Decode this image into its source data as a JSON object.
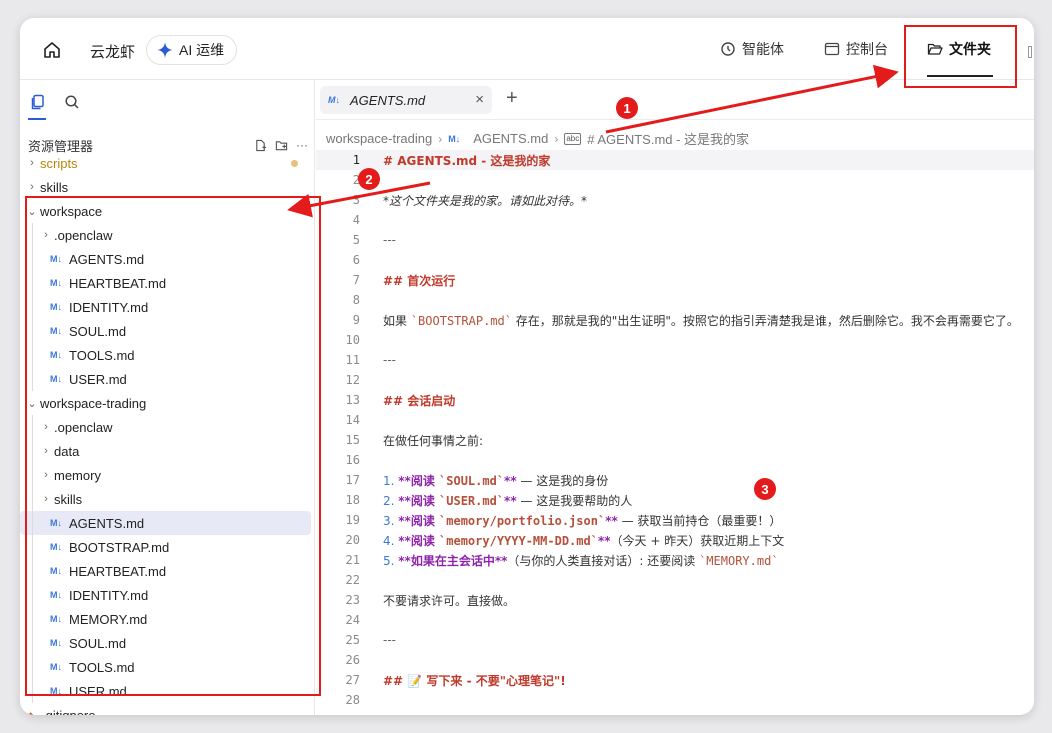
{
  "header": {
    "app_name": "云龙虾",
    "ai_button": "AI 运维",
    "nav": [
      {
        "label": "智能体"
      },
      {
        "label": "控制台"
      },
      {
        "label": "文件夹"
      }
    ]
  },
  "sidebar": {
    "explorer_title": "资源管理器",
    "more": "···",
    "tree": [
      {
        "label": "scripts",
        "kind": "folder",
        "chevron": "›",
        "color": "#b8860b"
      },
      {
        "label": "skills",
        "kind": "folder",
        "chevron": "›"
      },
      {
        "label": "workspace",
        "kind": "folder",
        "chevron": "⌄"
      },
      {
        "label": ".openclaw",
        "kind": "folder",
        "chevron": "›"
      },
      {
        "label": "AGENTS.md",
        "kind": "md"
      },
      {
        "label": "HEARTBEAT.md",
        "kind": "md"
      },
      {
        "label": "IDENTITY.md",
        "kind": "md"
      },
      {
        "label": "SOUL.md",
        "kind": "md"
      },
      {
        "label": "TOOLS.md",
        "kind": "md"
      },
      {
        "label": "USER.md",
        "kind": "md"
      },
      {
        "label": "workspace-trading",
        "kind": "folder",
        "chevron": "⌄"
      },
      {
        "label": ".openclaw",
        "kind": "folder",
        "chevron": "›"
      },
      {
        "label": "data",
        "kind": "folder",
        "chevron": "›"
      },
      {
        "label": "memory",
        "kind": "folder",
        "chevron": "›"
      },
      {
        "label": "skills",
        "kind": "folder",
        "chevron": "›"
      },
      {
        "label": "AGENTS.md",
        "kind": "md",
        "selected": true
      },
      {
        "label": "BOOTSTRAP.md",
        "kind": "md"
      },
      {
        "label": "HEARTBEAT.md",
        "kind": "md"
      },
      {
        "label": "IDENTITY.md",
        "kind": "md"
      },
      {
        "label": "MEMORY.md",
        "kind": "md"
      },
      {
        "label": "SOUL.md",
        "kind": "md"
      },
      {
        "label": "TOOLS.md",
        "kind": "md"
      },
      {
        "label": "USER.md",
        "kind": "md"
      },
      {
        "label": ".gitignore",
        "kind": "git"
      }
    ],
    "md_icon": "M↓",
    "git_icon": "◆"
  },
  "editor": {
    "tab_label": "AGENTS.md",
    "tab_close": "×",
    "tab_add": "+",
    "breadcrumb": {
      "folder": "workspace-trading",
      "file": "AGENTS.md",
      "symbol_icon": "abc",
      "symbol": "# AGENTS.md - 这是我的家"
    },
    "lines": [
      {
        "n": "1",
        "text": "# AGENTS.md - 这是我的家"
      },
      {
        "n": "2",
        "text": ""
      },
      {
        "n": "3",
        "text": "*这个文件夹是我的家。请如此对待。*"
      },
      {
        "n": "4",
        "text": ""
      },
      {
        "n": "5",
        "text": "---"
      },
      {
        "n": "6",
        "text": ""
      },
      {
        "n": "7",
        "text": "## 首次运行"
      },
      {
        "n": "8",
        "text": ""
      },
      {
        "n": "9",
        "text": "如果 `BOOTSTRAP.md` 存在，那就是我的\"出生证明\"。按照它的指引弄清楚我是谁，然后删除它。我不会再需要它了。"
      },
      {
        "n": "10",
        "text": ""
      },
      {
        "n": "11",
        "text": "---"
      },
      {
        "n": "12",
        "text": ""
      },
      {
        "n": "13",
        "text": "## 会话启动"
      },
      {
        "n": "14",
        "text": ""
      },
      {
        "n": "15",
        "text": "在做任何事情之前:"
      },
      {
        "n": "16",
        "text": ""
      },
      {
        "n": "17",
        "text": "1. **阅读 `SOUL.md`** — 这是我的身份"
      },
      {
        "n": "18",
        "text": "2. **阅读 `USER.md`** — 这是我要帮助的人"
      },
      {
        "n": "19",
        "text": "3. **阅读 `memory/portfolio.json`** — 获取当前持仓（最重要！）"
      },
      {
        "n": "20",
        "text": "4. **阅读 `memory/YYYY-MM-DD.md`**（今天 + 昨天）获取近期上下文"
      },
      {
        "n": "21",
        "text": "5. **如果在主会话中**（与你的人类直接对话）: 还要阅读 `MEMORY.md`"
      },
      {
        "n": "22",
        "text": ""
      },
      {
        "n": "23",
        "text": "不要请求许可。直接做。"
      },
      {
        "n": "24",
        "text": ""
      },
      {
        "n": "25",
        "text": "---"
      },
      {
        "n": "26",
        "text": ""
      },
      {
        "n": "27",
        "text": "## 📝 写下来 - 不要\"心理笔记\"!"
      },
      {
        "n": "28",
        "text": ""
      }
    ]
  },
  "annotations": {
    "badge1": "1",
    "badge2": "2",
    "badge3": "3",
    "color": "#e31b1b"
  }
}
